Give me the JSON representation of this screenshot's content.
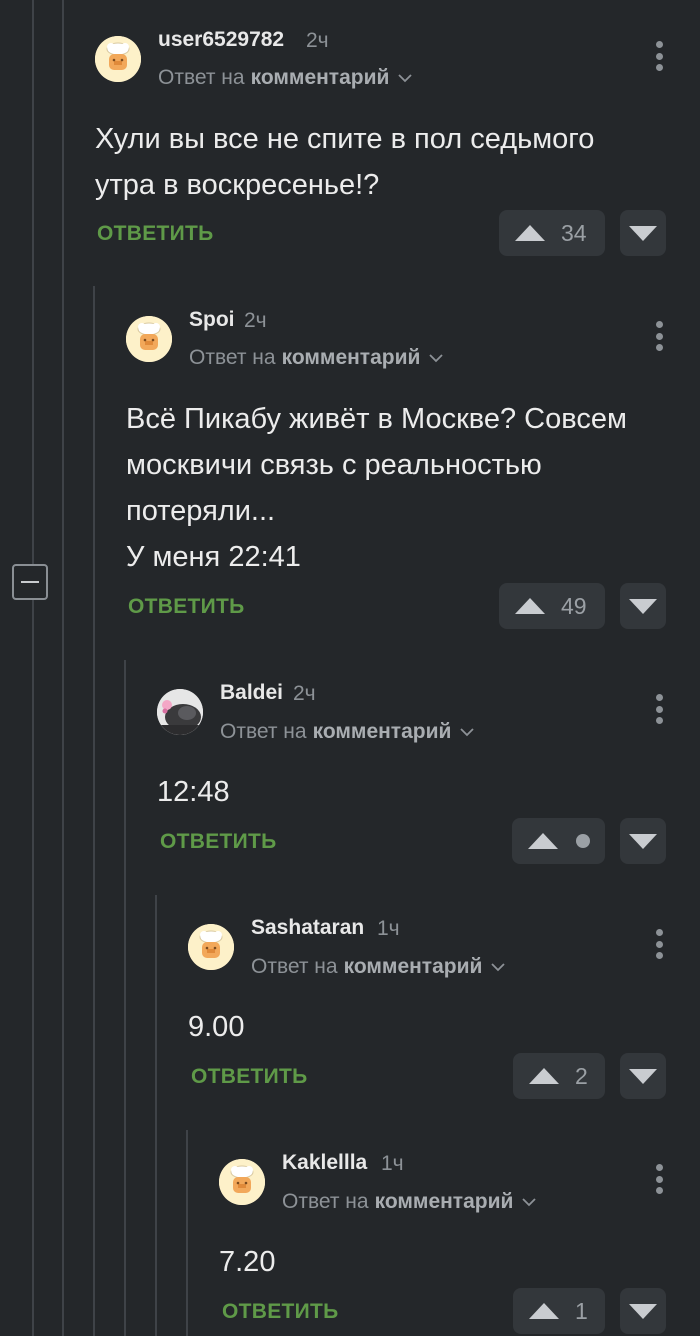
{
  "comments": [
    {
      "username": "user6529782",
      "time": "2ч",
      "reply_prefix": "Ответ на",
      "reply_target": "комментарий",
      "text": "Хули вы все не спите в пол седьмого\nутра в воскресенье!?",
      "reply_label": "ОТВЕТИТЬ",
      "rating": "34",
      "avatar": "chef-cat-icon"
    },
    {
      "username": "Spoi",
      "time": "2ч",
      "reply_prefix": "Ответ на",
      "reply_target": "комментарий",
      "text": "Всё Пикабу живёт в Москве? Совсем\nмосквичи связь с реальностью\nпотеряли...\nУ меня 22:41",
      "reply_label": "ОТВЕТИТЬ",
      "rating": "49",
      "avatar": "chef-cat-icon"
    },
    {
      "username": "Baldei",
      "time": "2ч",
      "reply_prefix": "Ответ на",
      "reply_target": "комментарий",
      "text": "12:48",
      "reply_label": "ОТВЕТИТЬ",
      "rating": "",
      "avatar": "custom-photo-avatar"
    },
    {
      "username": "Sashataran",
      "time": "1ч",
      "reply_prefix": "Ответ на",
      "reply_target": "комментарий",
      "text": "9.00",
      "reply_label": "ОТВЕТИТЬ",
      "rating": "2",
      "avatar": "chef-cat-icon"
    },
    {
      "username": "Kaklellla",
      "time": "1ч",
      "reply_prefix": "Ответ на",
      "reply_target": "комментарий",
      "text": "7.20",
      "reply_label": "ОТВЕТИТЬ",
      "rating": "1",
      "avatar": "chef-cat-icon"
    }
  ],
  "colors": {
    "background": "#24272a",
    "reply_green": "#5f9a48",
    "muted_text": "#8d9297",
    "vote_bg": "#33373b"
  }
}
